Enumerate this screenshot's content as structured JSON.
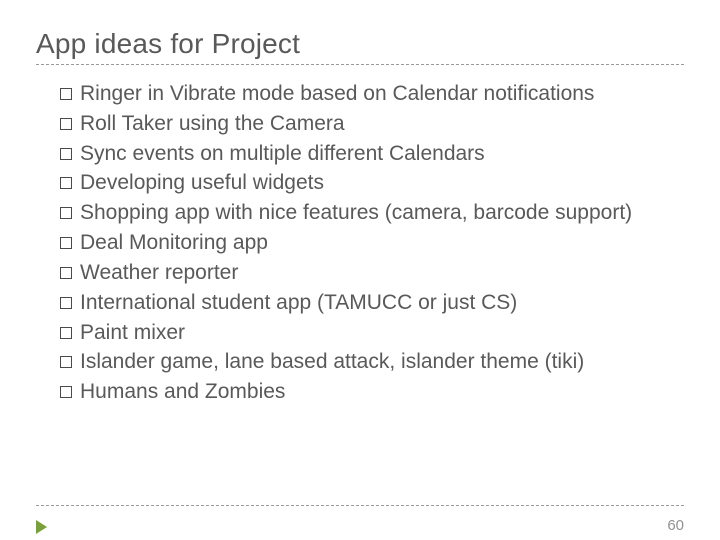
{
  "slide": {
    "title": "App ideas for Project",
    "items": [
      "Ringer in Vibrate mode based on Calendar notifications",
      "Roll Taker using the Camera",
      "Sync events on multiple different Calendars",
      "Developing useful widgets",
      "Shopping app with nice features (camera, barcode support)",
      "Deal Monitoring app",
      "Weather reporter",
      "International student app (TAMUCC or just CS)",
      "Paint mixer",
      "Islander game, lane based attack, islander theme (tiki)",
      "Humans and Zombies"
    ],
    "page_number": "60"
  }
}
